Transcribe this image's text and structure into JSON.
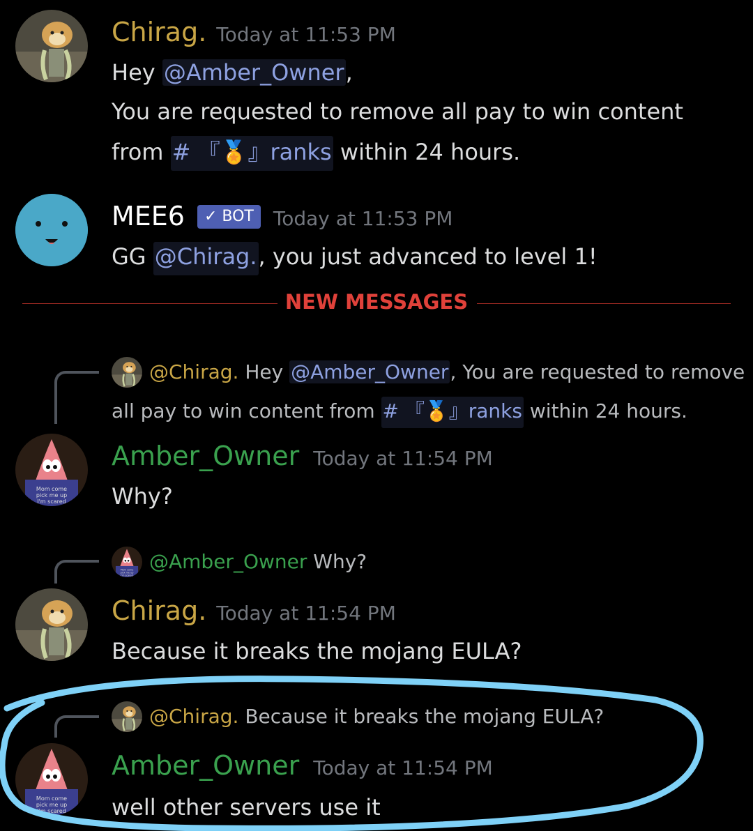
{
  "colors": {
    "chirag": "#c9a646",
    "amber": "#3aa14e",
    "mee6": "#ffffff",
    "new_messages": "#e0413a",
    "highlight": "#7fd1f7"
  },
  "msg1": {
    "username": "Chirag.",
    "timestamp": "Today at 11:53 PM",
    "l1_pre": "Hey ",
    "l1_mention": "@Amber_Owner",
    "l1_post": ",",
    "l2": "You are requested to remove all pay to win content",
    "l3_pre": "from ",
    "l3_channel": "# 『🏅』ranks",
    "l3_post": " within 24 hours."
  },
  "msg2": {
    "username": "MEE6",
    "badge": "✓ BOT",
    "timestamp": "Today at 11:53 PM",
    "pre": "GG ",
    "mention": "@Chirag.",
    "post": ", you just advanced to level 1!"
  },
  "divider": {
    "label": "NEW MESSAGES"
  },
  "msg3": {
    "reply_user": "@Chirag.",
    "reply_l1_pre": " Hey ",
    "reply_l1_mention": "@Amber_Owner",
    "reply_l1_post": ", You are requested to remove",
    "reply_l2_pre": "all pay to win content from ",
    "reply_l2_channel": "# 『🏅』ranks",
    "reply_l2_post": " within 24 hours.",
    "username": "Amber_Owner",
    "timestamp": "Today at 11:54 PM",
    "text": "Why?"
  },
  "msg4": {
    "reply_user": "@Amber_Owner",
    "reply_text": " Why?",
    "username": "Chirag.",
    "timestamp": "Today at 11:54 PM",
    "text": "Because it breaks the mojang EULA?"
  },
  "msg5": {
    "reply_user": "@Chirag.",
    "reply_text": " Because it breaks the mojang EULA?",
    "username": "Amber_Owner",
    "timestamp": "Today at 11:54 PM",
    "text": "well other servers use it"
  },
  "avatar_caption": "Mom come pick me up I'm scared"
}
